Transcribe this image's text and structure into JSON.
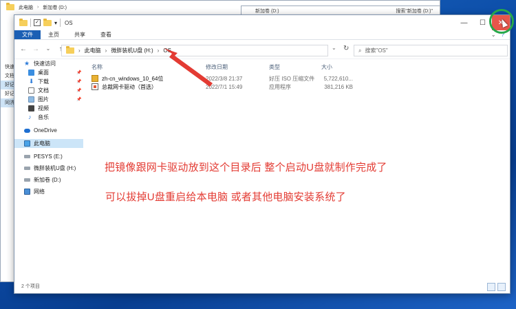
{
  "background_window": {
    "crumb_1": "此电脑",
    "crumb_2": "新加卷 (D:)",
    "side_items": [
      "快速",
      "文档",
      "好记",
      "好记",
      "同济"
    ],
    "second_crumb": "新加卷 (D:)",
    "second_search": "搜索\"新加卷 (D:)\""
  },
  "window": {
    "title": "OS",
    "controls": {
      "minimize": "—",
      "maximize": "☐",
      "close": "✕"
    }
  },
  "ribbon": {
    "tabs": [
      "文件",
      "主页",
      "共享",
      "查看"
    ],
    "expand": "⌄",
    "help": "?"
  },
  "addressbar": {
    "back": "←",
    "forward": "→",
    "recent": "⌄",
    "up": "↑",
    "crumbs": [
      "此电脑",
      "微胖装机U盘 (H:)",
      "OS"
    ],
    "dropdown": "⌄",
    "refresh": "↻",
    "search_placeholder": "搜索\"OS\""
  },
  "sidebar": {
    "items": [
      {
        "label": "快速访问",
        "icon": "star-icon"
      },
      {
        "label": "桌面",
        "icon": "desktop-icon",
        "pinned": true
      },
      {
        "label": "下载",
        "icon": "download-icon",
        "pinned": true
      },
      {
        "label": "文档",
        "icon": "documents-icon",
        "pinned": true
      },
      {
        "label": "图片",
        "icon": "pictures-icon",
        "pinned": true
      },
      {
        "label": "视频",
        "icon": "videos-icon"
      },
      {
        "label": "音乐",
        "icon": "music-icon"
      },
      {
        "label": "OneDrive",
        "icon": "onedrive-icon"
      },
      {
        "label": "此电脑",
        "icon": "this-pc-icon",
        "selected": true
      },
      {
        "label": "PESYS (E:)",
        "icon": "drive-icon"
      },
      {
        "label": "微胖装机U盘 (H:)",
        "icon": "drive-icon"
      },
      {
        "label": "新加卷 (D:)",
        "icon": "drive-icon"
      },
      {
        "label": "网络",
        "icon": "network-icon"
      }
    ]
  },
  "filelist": {
    "headers": [
      "名称",
      "修改日期",
      "类型",
      "大小"
    ],
    "rows": [
      {
        "name": "zh-cn_windows_10_64位",
        "date": "2022/3/8 21:37",
        "type": "好压 ISO 压缩文件",
        "size": "5,722,610...",
        "icon": "archive-icon"
      },
      {
        "name": "总裁网卡驱动（首选）",
        "date": "2022/7/1 15:49",
        "type": "应用程序",
        "size": "381,216 KB",
        "icon": "application-icon"
      }
    ]
  },
  "status": {
    "item_count": "2 个项目"
  },
  "annotations": {
    "line_1": "把镜像跟网卡驱动放到这个目录后 整个启动U盘就制作完成了",
    "line_2": "可以拔掉U盘重启给本电脑 或者其他电脑安装系统了",
    "color": "#e33b33"
  },
  "colors": {
    "ribbon_file_tab": "#1b5fb4",
    "close_button": "#e7564a",
    "sidebar_selected": "#cce5f8",
    "highlight_ring": "#27a84a"
  }
}
